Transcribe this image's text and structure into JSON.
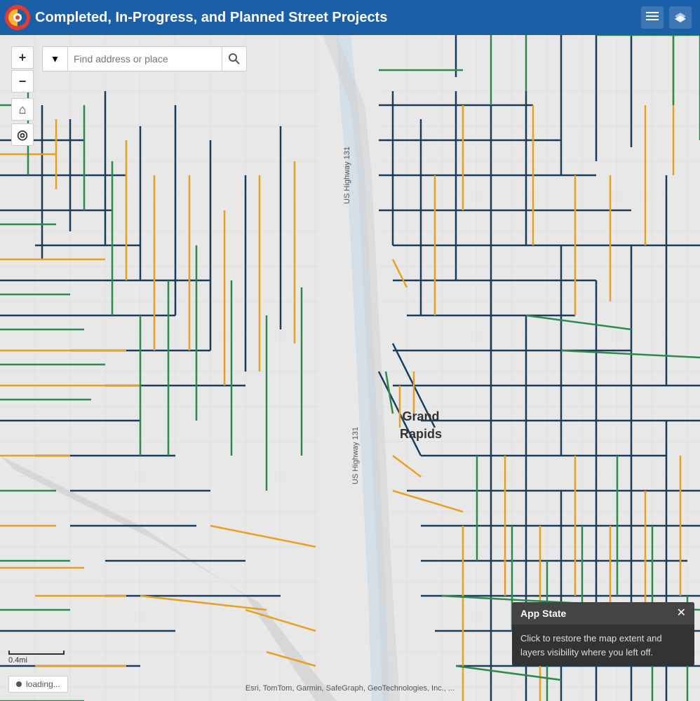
{
  "header": {
    "title": "Completed, In-Progress, and Planned Street Projects",
    "logo_alt": "ArcGIS logo"
  },
  "header_controls": {
    "layers_icon": "≡",
    "stack_icon": "⊞"
  },
  "search": {
    "placeholder": "Find address or place",
    "dropdown_icon": "▾",
    "search_icon": "🔍"
  },
  "map": {
    "city_label": "Grand\nRapids",
    "highway_label": "US Highway 131"
  },
  "map_controls": {
    "zoom_in": "+",
    "zoom_out": "−",
    "home": "⌂",
    "locate": "◎"
  },
  "scale": {
    "label": "0.4mi"
  },
  "loading": {
    "text": "loading..."
  },
  "attribution": {
    "text": "Esri, TomTom, Garmin, SafeGraph, GeoTechnologies, Inc., ..."
  },
  "app_state_popup": {
    "title": "App State",
    "close_icon": "✕",
    "body": "Click to restore the map extent and layers visibility where you left off."
  },
  "colors": {
    "header_bg": "#1a5fa8",
    "map_bg": "#e8e8e8",
    "road_completed": "#1a3d5c",
    "road_inprogress": "#e8a020",
    "road_planned": "#2d8a4e",
    "highway": "#cccccc",
    "water": "#b0c4d8"
  }
}
